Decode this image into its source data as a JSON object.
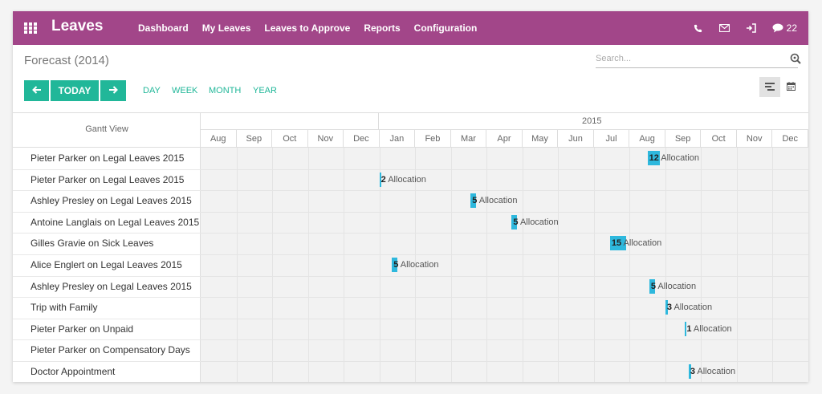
{
  "app": {
    "brand": "Leaves",
    "menu": [
      "Dashboard",
      "My Leaves",
      "Leaves to Approve",
      "Reports",
      "Configuration"
    ],
    "message_count": "22"
  },
  "control": {
    "title": "Forecast (2014)",
    "search_placeholder": "Search...",
    "today_label": "TODAY",
    "scales": [
      "DAY",
      "WEEK",
      "MONTH",
      "YEAR"
    ]
  },
  "gantt": {
    "header_label": "Gantt View",
    "year_label": "2015",
    "months": [
      "Aug",
      "Sep",
      "Oct",
      "Nov",
      "Dec",
      "Jan",
      "Feb",
      "Mar",
      "Apr",
      "May",
      "Jun",
      "Jul",
      "Aug",
      "Sep",
      "Oct",
      "Nov",
      "Dec"
    ],
    "rows": [
      {
        "label": "Pieter Parker on Legal Leaves 2015",
        "count": "12",
        "text": "Allocation",
        "month_pos": 12.5,
        "span": 0.35
      },
      {
        "label": "Pieter Parker on Legal Leaves 2015",
        "count": "2",
        "text": "Allocation",
        "month_pos": 5.0,
        "span": 0.05
      },
      {
        "label": "Ashley Presley on Legal Leaves 2015",
        "count": "5",
        "text": "Allocation",
        "month_pos": 7.55,
        "span": 0.15
      },
      {
        "label": "Antoine Langlais on Legal Leaves 2015",
        "count": "5",
        "text": "Allocation",
        "month_pos": 8.7,
        "span": 0.15
      },
      {
        "label": "Gilles Gravie on Sick Leaves",
        "count": "15",
        "text": "Allocation",
        "month_pos": 11.45,
        "span": 0.45
      },
      {
        "label": "Alice Englert on Legal Leaves 2015",
        "count": "5",
        "text": "Allocation",
        "month_pos": 5.35,
        "span": 0.15
      },
      {
        "label": "Ashley Presley on Legal Leaves 2015",
        "count": "5",
        "text": "Allocation",
        "month_pos": 12.55,
        "span": 0.15
      },
      {
        "label": "Trip with Family",
        "count": "3",
        "text": "Allocation",
        "month_pos": 13.0,
        "span": 0.08
      },
      {
        "label": "Pieter Parker on Unpaid",
        "count": "1",
        "text": "Allocation",
        "month_pos": 13.55,
        "span": 0.04
      },
      {
        "label": "Pieter Parker on Compensatory Days",
        "count": "",
        "text": "",
        "month_pos": null,
        "span": 0
      },
      {
        "label": "Doctor Appointment",
        "count": "3",
        "text": "Allocation",
        "month_pos": 13.65,
        "span": 0.08
      }
    ]
  },
  "colors": {
    "topbar": "#a24689",
    "accent": "#21b799",
    "bar": "#2eb8dd"
  }
}
